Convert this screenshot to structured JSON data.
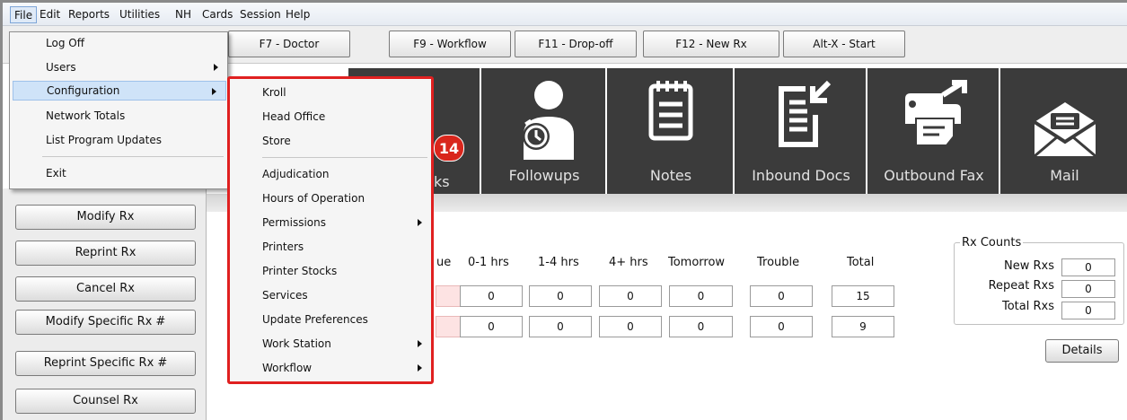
{
  "menubar": {
    "items": [
      "File",
      "Edit",
      "Reports",
      "Utilities",
      "NH",
      "Cards",
      "Session",
      "Help"
    ]
  },
  "toolbar": {
    "buttons": [
      "F7 - Doctor",
      "F9 - Workflow",
      "F11 - Drop-off",
      "F12 - New Rx",
      "Alt-X - Start"
    ]
  },
  "tiles": {
    "partial_label": "ks",
    "badge": "14",
    "items": [
      "Followups",
      "Notes",
      "Inbound Docs",
      "Outbound Fax",
      "Mail"
    ]
  },
  "left_panel": {
    "buttons": [
      "Modify Rx",
      "Reprint Rx",
      "Cancel Rx",
      "Modify Specific Rx #",
      "Reprint Specific Rx #",
      "Counsel Rx"
    ]
  },
  "stats": {
    "headers": [
      "ue",
      "0-1 hrs",
      "1-4 hrs",
      "4+ hrs",
      "Tomorrow",
      "Trouble",
      "Total"
    ],
    "rows": [
      [
        "",
        "0",
        "0",
        "0",
        "0",
        "0",
        "15"
      ],
      [
        "",
        "0",
        "0",
        "0",
        "0",
        "0",
        "9"
      ]
    ]
  },
  "rx_counts": {
    "title": "Rx Counts",
    "rows": [
      {
        "label": "New Rxs",
        "value": "0"
      },
      {
        "label": "Repeat Rxs",
        "value": "0"
      },
      {
        "label": "Total Rxs",
        "value": "0"
      }
    ],
    "details_label": "Details"
  },
  "file_menu": {
    "items": [
      "Log Off",
      "Users",
      "Configuration",
      "Network Totals",
      "List Program Updates",
      "Exit"
    ]
  },
  "config_submenu": {
    "items": [
      "Kroll",
      "Head Office",
      "Store",
      "Adjudication",
      "Hours of Operation",
      "Permissions",
      "Printers",
      "Printer Stocks",
      "Services",
      "Update Preferences",
      "Work Station",
      "Workflow"
    ]
  },
  "colors": {
    "tile_bg": "#3b3b3b",
    "badge": "#d9261c",
    "highlight_border": "#e02020",
    "menu_highlight": "#cfe3f8"
  }
}
